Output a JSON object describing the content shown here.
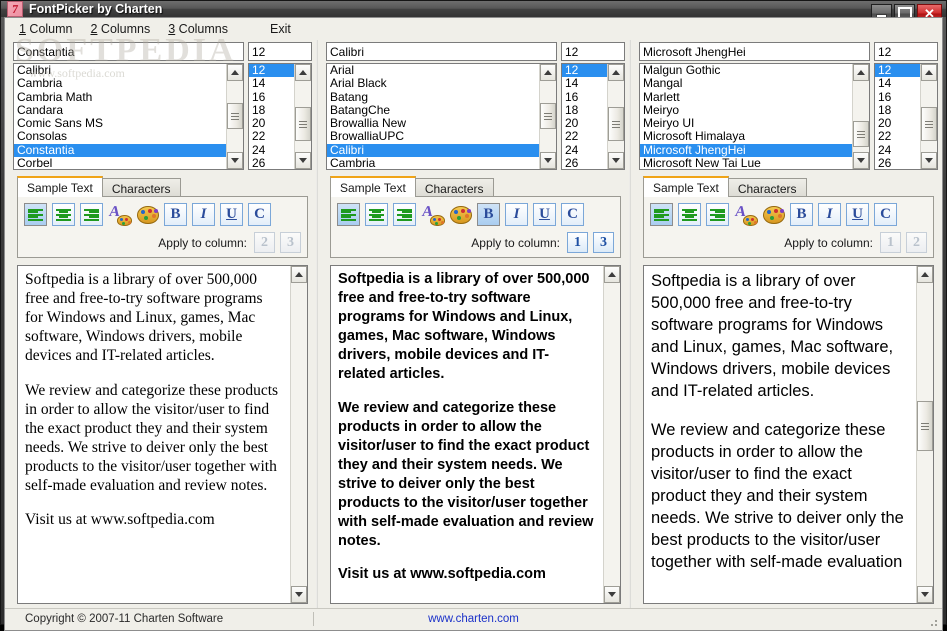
{
  "window": {
    "title": "FontPicker by Charten",
    "icon": "app-logo-icon",
    "minimize_label": "",
    "maximize_label": "",
    "close_label": "✕"
  },
  "watermark": {
    "big": "SOFTPEDIA",
    "small": "www.softpedia.com"
  },
  "menu": [
    {
      "accel": "1",
      "rest": " Column"
    },
    {
      "accel": "2",
      "rest": " Columns"
    },
    {
      "accel": "3",
      "rest": " Columns"
    },
    {
      "accel": "",
      "rest": "Exit"
    }
  ],
  "columns": [
    {
      "font_value": "Constantia",
      "size_value": "12",
      "fonts": [
        "Calibri",
        "Cambria",
        "Cambria Math",
        "Candara",
        "Comic Sans MS",
        "Consolas",
        "Constantia",
        "Corbel"
      ],
      "font_selected": "Constantia",
      "sizes": [
        "12",
        "14",
        "16",
        "18",
        "20",
        "22",
        "24",
        "26"
      ],
      "size_selected": "12",
      "tabs": [
        {
          "label": "Sample Text",
          "active": true
        },
        {
          "label": "Characters",
          "active": false
        }
      ],
      "align_active": "left",
      "bold_pressed": false,
      "italic_pressed": false,
      "underline_pressed": false,
      "color_pressed": false,
      "bold_label": "B",
      "italic_label": "I",
      "underline_label": "U",
      "color_label": "C",
      "apply_label": "Apply to column:",
      "apply_buttons": [
        {
          "label": "2",
          "enabled": false
        },
        {
          "label": "3",
          "enabled": false
        }
      ],
      "sample_paragraphs": [
        "Softpedia is a library of over 500,000 free and free-to-try software programs for Windows and Linux, games, Mac software, Windows drivers, mobile devices and IT-related articles.",
        "We review and categorize these products in order to allow the visitor/user to find the exact product they and their system needs. We strive to deiver only the best products to the visitor/user together with self-made evaluation and review notes.",
        "Visit us at www.softpedia.com"
      ]
    },
    {
      "font_value": "Calibri",
      "size_value": "12",
      "fonts": [
        "Arial",
        "Arial Black",
        "Batang",
        "BatangChe",
        "Browallia New",
        "BrowalliaUPC",
        "Calibri",
        "Cambria"
      ],
      "font_selected": "Calibri",
      "sizes": [
        "12",
        "14",
        "16",
        "18",
        "20",
        "22",
        "24",
        "26"
      ],
      "size_selected": "12",
      "tabs": [
        {
          "label": "Sample Text",
          "active": true
        },
        {
          "label": "Characters",
          "active": false
        }
      ],
      "align_active": "left",
      "bold_pressed": true,
      "italic_pressed": false,
      "underline_pressed": false,
      "color_pressed": false,
      "bold_label": "B",
      "italic_label": "I",
      "underline_label": "U",
      "color_label": "C",
      "apply_label": "Apply to column:",
      "apply_buttons": [
        {
          "label": "1",
          "enabled": true
        },
        {
          "label": "3",
          "enabled": true
        }
      ],
      "sample_paragraphs": [
        "Softpedia is a library of over 500,000 free and free-to-try software programs for Windows and Linux, games, Mac software, Windows drivers, mobile devices and IT-related articles.",
        "We review and categorize these products in order to allow the visitor/user to find the exact product they and their system needs. We strive to deiver only the best products to the visitor/user together with self-made evaluation and review notes.",
        "Visit us at www.softpedia.com"
      ]
    },
    {
      "font_value": "Microsoft JhengHei",
      "size_value": "12",
      "fonts": [
        "Malgun Gothic",
        "Mangal",
        "Marlett",
        "Meiryo",
        "Meiryo UI",
        "Microsoft Himalaya",
        "Microsoft JhengHei",
        "Microsoft New Tai Lue"
      ],
      "font_selected": "Microsoft JhengHei",
      "sizes": [
        "12",
        "14",
        "16",
        "18",
        "20",
        "22",
        "24",
        "26"
      ],
      "size_selected": "12",
      "tabs": [
        {
          "label": "Sample Text",
          "active": true
        },
        {
          "label": "Characters",
          "active": false
        }
      ],
      "align_active": "left",
      "bold_pressed": false,
      "italic_pressed": false,
      "underline_pressed": false,
      "color_pressed": false,
      "bold_label": "B",
      "italic_label": "I",
      "underline_label": "U",
      "color_label": "C",
      "apply_label": "Apply to column:",
      "apply_buttons": [
        {
          "label": "1",
          "enabled": false
        },
        {
          "label": "2",
          "enabled": false
        }
      ],
      "sample_paragraphs": [
        "Softpedia is a library of over 500,000 free and free-to-try software programs for Windows and Linux, games, Mac software, Windows drivers, mobile devices and IT-related articles.",
        "We review and categorize these products in order to allow the visitor/user to find the exact product they and their system needs. We strive to deiver only the best products to the visitor/user together with self-made evaluation"
      ]
    }
  ],
  "statusbar": {
    "copyright": "Copyright © 2007-11 Charten Software",
    "link": "www.charten.com"
  },
  "colors": {
    "selection_blue": "#2a8fef",
    "tab_accent": "#f0a417",
    "link_blue": "#1b31c9",
    "close_red": "#cf2d2d",
    "icon_green": "#1f9a1f"
  }
}
